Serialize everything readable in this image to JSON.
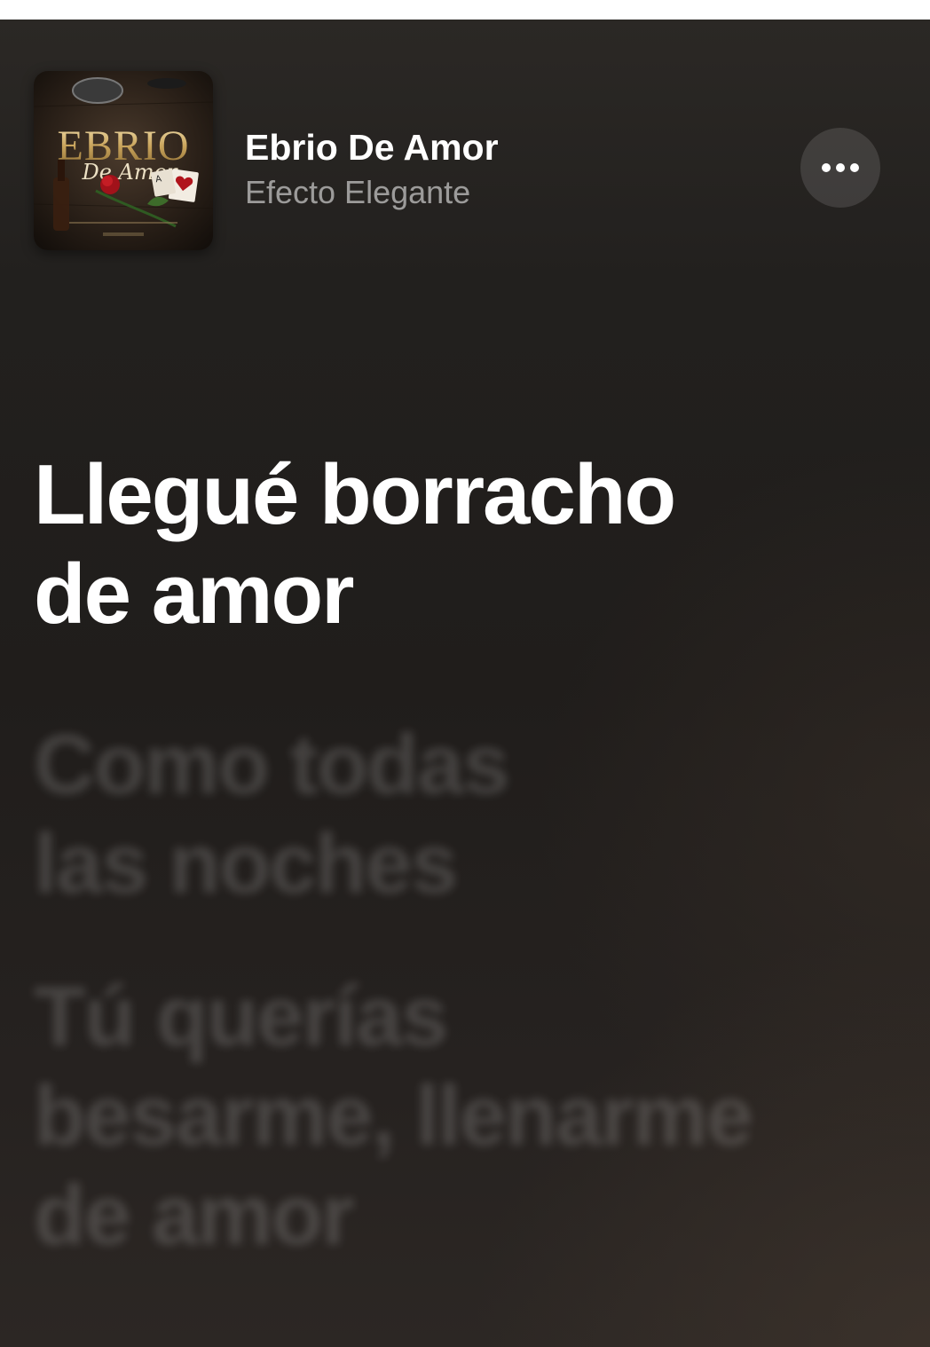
{
  "track": {
    "title": "Ebrio De Amor",
    "artist": "Efecto Elegante"
  },
  "artwork": {
    "title_word_1": "EBRIO",
    "title_word_2": "De Amor",
    "icon": "album-artwork"
  },
  "more_button": {
    "icon": "ellipsis-icon"
  },
  "lyrics": [
    {
      "text": "Llegué borracho\nde amor",
      "active": true
    },
    {
      "text": "Como todas\nlas noches",
      "active": false
    },
    {
      "text": "Tú querías\nbesarme, llenarme\nde amor",
      "active": false
    }
  ],
  "colors": {
    "background": "#221f1d",
    "lyric_active": "#ffffff",
    "artist_text": "#8c8986"
  }
}
